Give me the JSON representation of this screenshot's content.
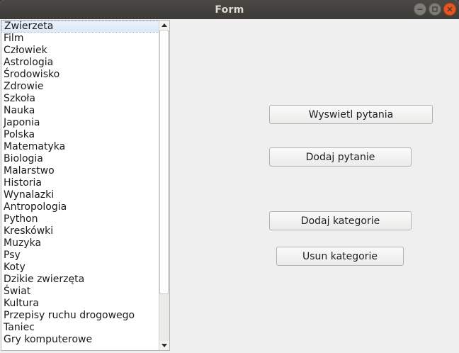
{
  "window": {
    "title": "Form",
    "controls": [
      "minimize-icon",
      "maximize-icon",
      "close-icon"
    ],
    "accent_close": "#e95420"
  },
  "list": {
    "items": [
      "Zwierzeta",
      "Film",
      "Człowiek",
      "Astrologia",
      "Środowisko",
      "Zdrowie",
      "Szkoła",
      "Nauka",
      "Japonia",
      "Polska",
      "Matematyka",
      "Biologia",
      "Malarstwo",
      "Historia",
      "Wynalazki",
      "Antropologia",
      "Python",
      "Kreskówki",
      "Muzyka",
      "Psy",
      "Koty",
      "Dzikie zwierzęta",
      "Świat",
      "Kultura",
      "Przepisy ruchu drogowego",
      "Taniec",
      "Gry komputerowe"
    ],
    "selected_index": 0,
    "scroll_fraction_visible": 0.85,
    "scroll_position": 0.0
  },
  "buttons": {
    "show_questions": "Wyswietl pytania",
    "add_question": "Dodaj pytanie",
    "add_category": "Dodaj kategorie",
    "remove_category": "Usun kategorie"
  }
}
